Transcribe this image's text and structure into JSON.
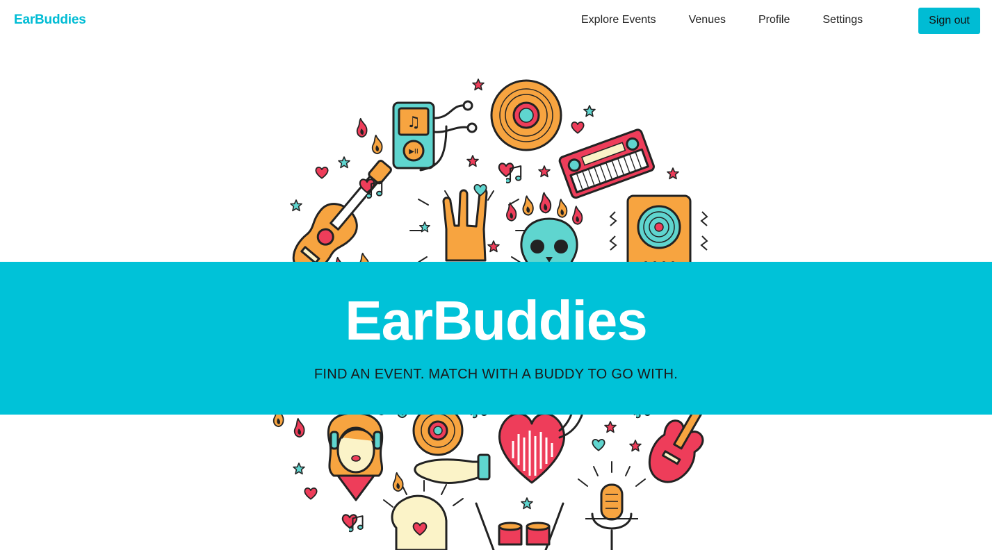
{
  "navbar": {
    "brand": "EarBuddies",
    "links": [
      "Explore Events",
      "Venues",
      "Profile",
      "Settings"
    ],
    "signout_label": "Sign out"
  },
  "hero": {
    "title": "EarBuddies",
    "subtitle": "FIND AN EVENT. MATCH WITH A BUDDY TO GO WITH."
  },
  "colors": {
    "brand": "#00bcd4",
    "band": "#00c2d8",
    "orange": "#f7a440",
    "red": "#ee3d5a",
    "teal": "#5fd5cf",
    "cream": "#fbf3c8"
  },
  "icons": [
    "mp3-player-icon",
    "vinyl-record-icon",
    "synthesizer-icon",
    "guitar-icon",
    "rock-hand-icon",
    "skull-icon",
    "speaker-icon",
    "woman-headphones-icon",
    "hand-record-icon",
    "heart-equalizer-icon",
    "electric-guitar-icon",
    "head-icon",
    "drum-kit-icon",
    "microphone-icon",
    "star-icon",
    "heart-icon",
    "music-note-icon",
    "flame-icon"
  ]
}
